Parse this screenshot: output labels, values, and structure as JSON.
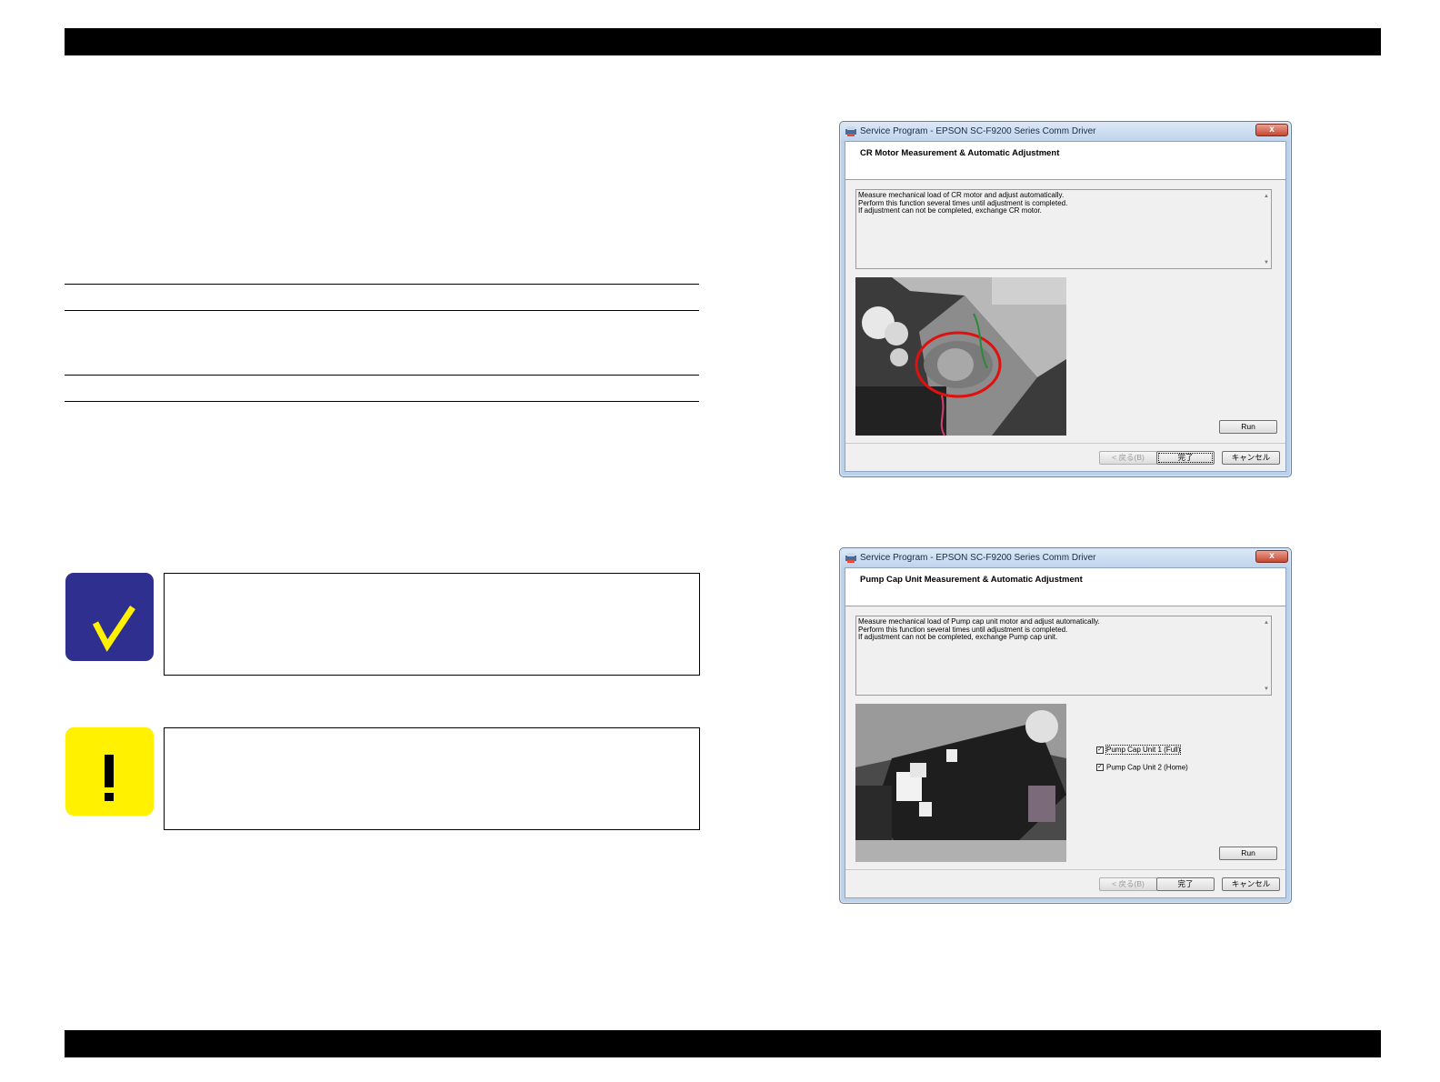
{
  "dialogs": [
    {
      "window_title": "Service Program - EPSON SC-F9200 Series Comm Driver",
      "close_label": "x",
      "heading": "CR Motor Measurement & Automatic Adjustment",
      "description": [
        "Measure mechanical load of CR motor and adjust automatically.",
        "Perform this function several times until adjustment is completed.",
        "If adjustment can not be completed, exchange CR motor."
      ],
      "run_label": "Run",
      "back_label": "< 戻る(B)",
      "finish_label": "完了",
      "cancel_label": "キャンセル"
    },
    {
      "window_title": "Service Program - EPSON SC-F9200 Series Comm Driver",
      "close_label": "x",
      "heading": "Pump Cap Unit Measurement & Automatic Adjustment",
      "description": [
        "Measure mechanical load of Pump cap unit motor and adjust automatically.",
        "Perform this function several times until adjustment is completed.",
        "If adjustment can not be completed, exchange Pump cap unit."
      ],
      "checkboxes": [
        {
          "label": "Pump Cap Unit 1 (Full)",
          "checked": true
        },
        {
          "label": "Pump Cap Unit 2 (Home)",
          "checked": true
        }
      ],
      "run_label": "Run",
      "back_label": "< 戻る(B)",
      "finish_label": "完了",
      "cancel_label": "キャンセル"
    }
  ],
  "colors": {
    "check_icon_bg": "#2f2f8f",
    "check_mark": "#fff100",
    "caution_icon_bg": "#fff100",
    "caution_mark": "#000000"
  },
  "icons": {
    "check": "check-icon",
    "caution": "exclamation-icon"
  }
}
